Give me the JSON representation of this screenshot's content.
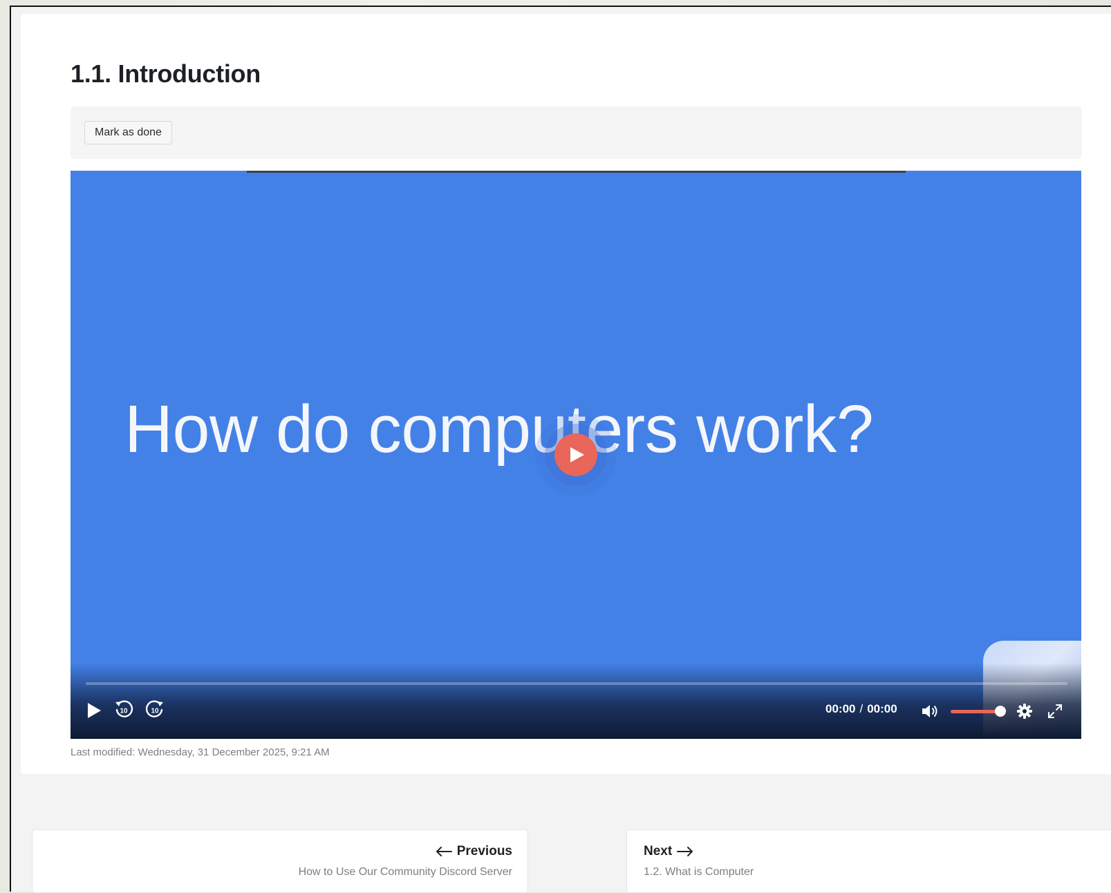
{
  "page": {
    "title": "1.1. Introduction",
    "mark_done_label": "Mark as done",
    "last_modified": "Last modified: Wednesday, 31 December 2025, 9:21 AM"
  },
  "video": {
    "slide_text": "How do computers work?",
    "current_time": "00:00",
    "time_separator": "/",
    "duration": "00:00",
    "progress": 0,
    "volume": 0.9,
    "colors": {
      "background": "#4381e7",
      "accent": "#e8665a"
    },
    "icons": [
      "play-icon",
      "rewind-10-icon",
      "forward-10-icon",
      "volume-icon",
      "settings-icon",
      "fullscreen-icon"
    ]
  },
  "navigation": {
    "previous": {
      "label": "Previous",
      "title": "How to Use Our Community Discord Server"
    },
    "next": {
      "label": "Next",
      "title": "1.2. What is Computer"
    }
  }
}
